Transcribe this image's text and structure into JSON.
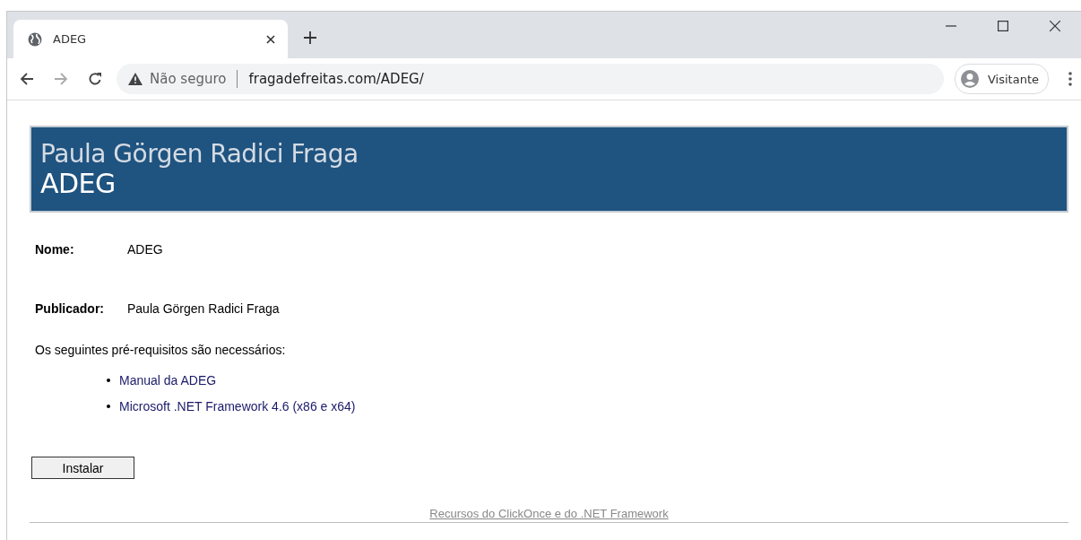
{
  "browser": {
    "tabs": [
      {
        "title": "ADEG",
        "selected": true
      }
    ],
    "address": {
      "security": "Não seguro",
      "url": "fragadefreitas.com/ADEG/"
    },
    "profile": "Visitante"
  },
  "page": {
    "banner": {
      "publisher": "Paula Görgen Radici Fraga",
      "product": "ADEG"
    },
    "fields": [
      {
        "label": "Nome:",
        "value": "ADEG"
      },
      {
        "label": "Publicador:",
        "value": "Paula Görgen Radici Fraga"
      }
    ],
    "prerequisites_intro": "Os seguintes pré-requisitos são necessários:",
    "prerequisites": [
      "Manual da ADEG",
      "Microsoft .NET Framework 4.6 (x86 e x64)"
    ],
    "install_button": "Instalar",
    "footer_link": "Recursos do ClickOnce e do .NET Framework"
  }
}
